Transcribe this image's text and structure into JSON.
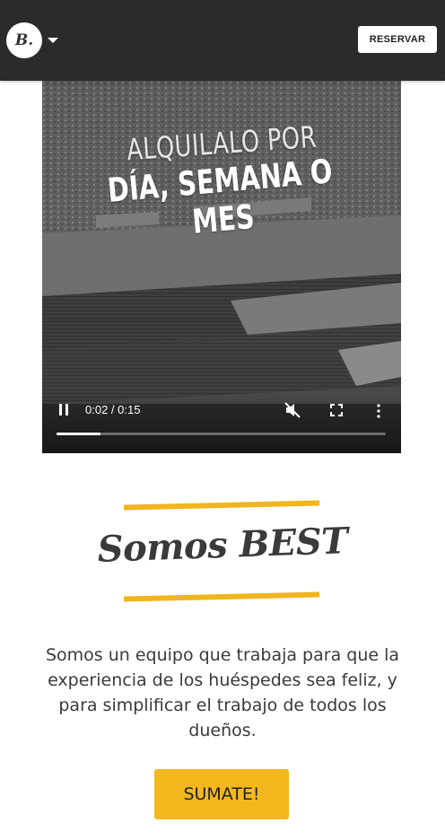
{
  "header": {
    "logo_text": "B.",
    "logo_menu_icon": "chevron-down-icon",
    "reserve_label": "RESERVAR"
  },
  "video": {
    "line1": "ALQUILALO POR",
    "line2": "DÍA, SEMANA O MES",
    "time": "0:02 / 0:15",
    "progress": 0.133,
    "muted": true,
    "icons": [
      "pause-icon",
      "mute-icon",
      "fullscreen-icon",
      "more-vert-icon"
    ]
  },
  "intro": {
    "title": "Somos BEST",
    "description": "Somos un equipo que trabaja para que la experiencia de los huéspedes sea feliz, y para simplificar el trabajo de todos los dueños.",
    "cta_label": "SUMATE!"
  },
  "colors": {
    "header_bg": "#2b2b2a",
    "accent": "#f4b81e"
  }
}
